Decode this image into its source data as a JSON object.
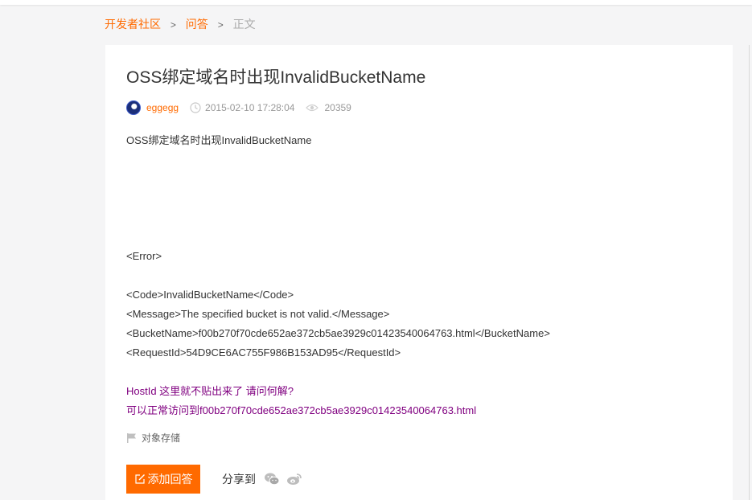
{
  "breadcrumb": {
    "community": "开发者社区",
    "qa": "问答",
    "current": "正文",
    "separator": ">"
  },
  "post": {
    "title": "OSS绑定域名时出现InvalidBucketName",
    "author": "eggegg",
    "date": "2015-02-10 17:28:04",
    "views": "20359",
    "lines": {
      "intro": "OSS绑定域名时出现InvalidBucketName",
      "error_open": "<Error>",
      "code": "<Code>InvalidBucketName</Code>",
      "message": "<Message>The specified bucket is not valid.</Message>",
      "bucket_name": "<BucketName>f00b270f70cde652ae372cb5ae3929c01423540064763.html</BucketName>",
      "request_id": "<RequestId>54D9CE6AC755F986B153AD95</RequestId>",
      "host_id": "HostId 这里就不贴出来了 请问何解?",
      "access_note": "可以正常访问到f00b270f70cde652ae372cb5ae3929c01423540064763.html"
    },
    "tag": "对象存储"
  },
  "actions": {
    "add_answer": "添加回答",
    "share_label": "分享到"
  },
  "icons": {
    "clock": "clock-icon",
    "eye": "eye-icon",
    "flag": "flag-icon",
    "edit": "edit-icon",
    "wechat": "wechat-icon",
    "weibo": "weibo-icon"
  },
  "colors": {
    "accent": "#ff6a00",
    "text": "#333333",
    "muted": "#999999",
    "link_purple": "#800080",
    "background": "#f5f5f6"
  }
}
